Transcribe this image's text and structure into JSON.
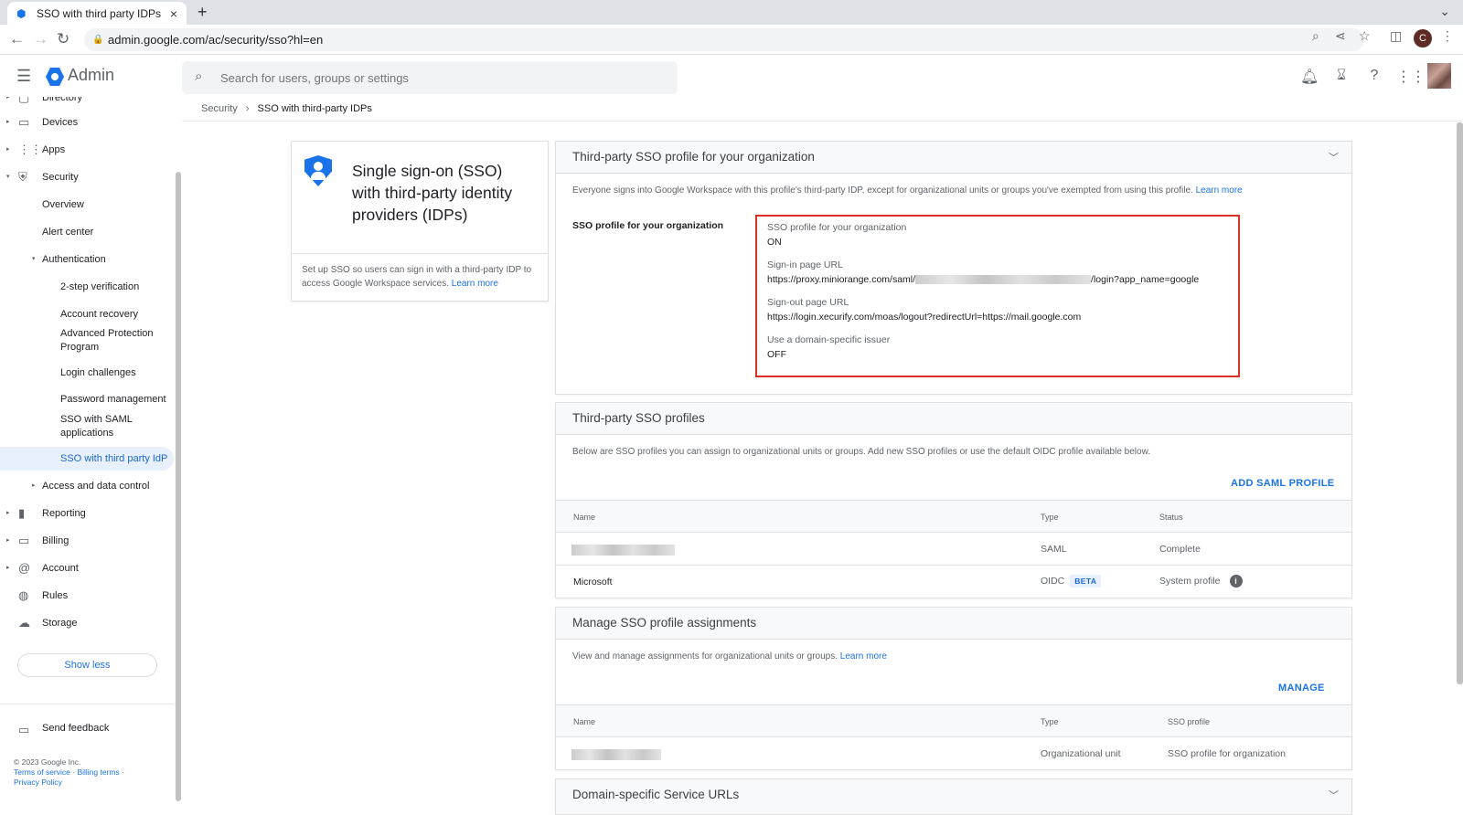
{
  "browser": {
    "tab_title": "SSO with third party IDPs",
    "url": "admin.google.com/ac/security/sso?hl=en",
    "profile_initial": "C"
  },
  "header": {
    "app_name": "Admin",
    "search_placeholder": "Search for users, groups or settings"
  },
  "breadcrumb": {
    "parent": "Security",
    "current": "SSO with third-party IDPs"
  },
  "sidebar": {
    "items": [
      {
        "label": "Directory"
      },
      {
        "label": "Devices"
      },
      {
        "label": "Apps"
      },
      {
        "label": "Security"
      },
      {
        "label": "Overview"
      },
      {
        "label": "Alert center"
      },
      {
        "label": "Authentication"
      },
      {
        "label": "2-step verification"
      },
      {
        "label": "Account recovery"
      },
      {
        "label": "Advanced Protection Program"
      },
      {
        "label": "Login challenges"
      },
      {
        "label": "Password management"
      },
      {
        "label": "SSO with SAML applications"
      },
      {
        "label": "SSO with third party IdP"
      },
      {
        "label": "Access and data control"
      },
      {
        "label": "Reporting"
      },
      {
        "label": "Billing"
      },
      {
        "label": "Account"
      },
      {
        "label": "Rules"
      },
      {
        "label": "Storage"
      }
    ],
    "show_less": "Show less",
    "send_feedback": "Send feedback",
    "copyright": "© 2023 Google Inc.",
    "terms": "Terms of service",
    "billing_terms": "Billing terms",
    "privacy": "Privacy Policy"
  },
  "intro_card": {
    "title": "Single sign-on (SSO) with third-party identity providers (IDPs)",
    "description": "Set up SSO so users can sign in with a third-party IDP to access Google Workspace services.",
    "learn_more": "Learn more"
  },
  "org_profile": {
    "title": "Third-party SSO profile for your organization",
    "description": "Everyone signs into Google Workspace with this profile's third-party IDP, except for organizational units or groups you've exempted from using this profile.",
    "learn_more": "Learn more",
    "row_label": "SSO profile for your organization",
    "fields": {
      "sso_label": "SSO profile for your organization",
      "sso_value": "ON",
      "signin_label": "Sign-in page URL",
      "signin_prefix": "https://proxy.miniorange.com/saml/",
      "signin_suffix": "/login?app_name=google",
      "signout_label": "Sign-out page URL",
      "signout_value": "https://login.xecurify.com/moas/logout?redirectUrl=https://mail.google.com",
      "issuer_label": "Use a domain-specific issuer",
      "issuer_value": "OFF"
    }
  },
  "profiles": {
    "title": "Third-party SSO profiles",
    "description": "Below are SSO profiles you can assign to organizational units or groups. Add new SSO profiles or use the default OIDC profile available below.",
    "add_button": "ADD SAML PROFILE",
    "columns": {
      "name": "Name",
      "type": "Type",
      "status": "Status"
    },
    "rows": [
      {
        "name": "",
        "type": "SAML",
        "status": "Complete"
      },
      {
        "name": "Microsoft",
        "type": "OIDC",
        "badge": "BETA",
        "status": "System profile"
      }
    ]
  },
  "assignments": {
    "title": "Manage SSO profile assignments",
    "description": "View and manage assignments for organizational units or groups.",
    "learn_more": "Learn more",
    "manage_button": "MANAGE",
    "columns": {
      "name": "Name",
      "type": "Type",
      "profile": "SSO profile"
    },
    "rows": [
      {
        "name": "",
        "type": "Organizational unit",
        "profile": "SSO profile for organization"
      }
    ]
  },
  "domain_urls": {
    "title": "Domain-specific Service URLs"
  }
}
